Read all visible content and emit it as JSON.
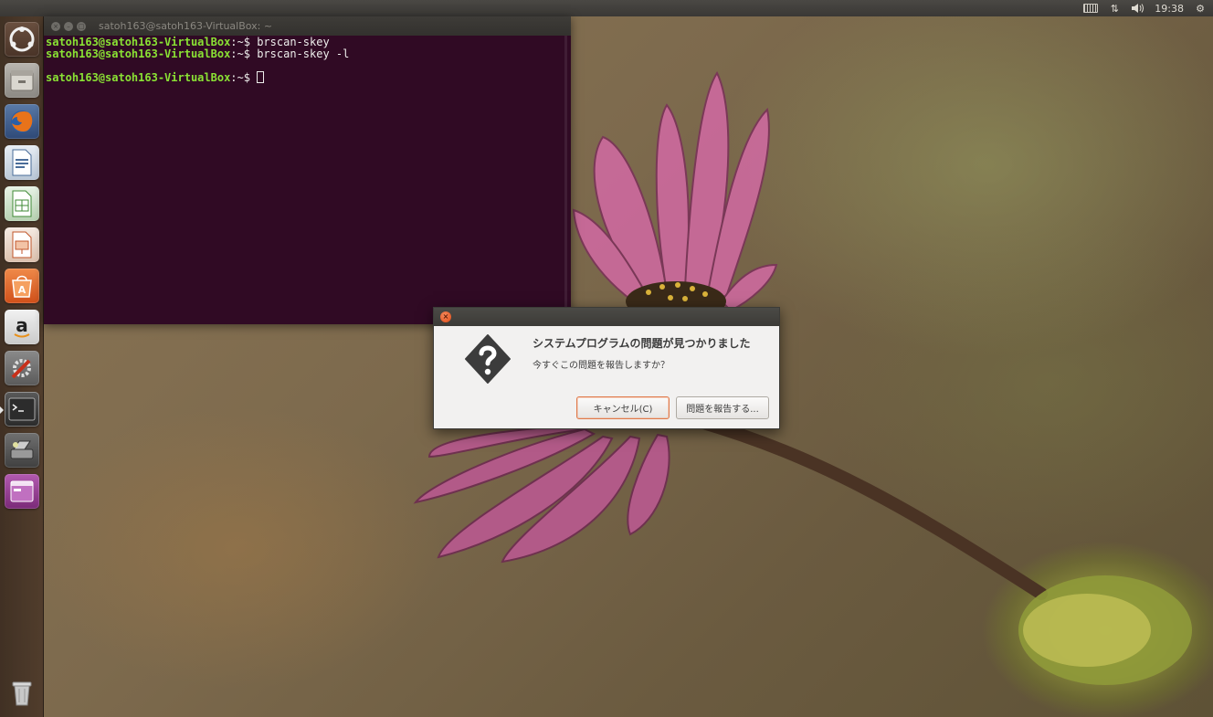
{
  "top_panel": {
    "clock": "19:38",
    "indicators": [
      "keyboard-icon",
      "network-icon",
      "volume-icon",
      "power-gear-icon"
    ]
  },
  "launcher": {
    "items": [
      "ubuntu-dash-icon",
      "files-icon",
      "firefox-icon",
      "libreoffice-writer-icon",
      "libreoffice-calc-icon",
      "libreoffice-impress-icon",
      "software-center-icon",
      "amazon-icon",
      "system-settings-icon",
      "terminal-icon",
      "scanner-icon",
      "window-app-icon",
      "trash-icon"
    ]
  },
  "terminal": {
    "title": "satoh163@satoh163-VirtualBox: ~",
    "lines": [
      {
        "prompt": "satoh163@satoh163-VirtualBox",
        "path": ":~$ ",
        "command": "brscan-skey"
      },
      {
        "prompt": "satoh163@satoh163-VirtualBox",
        "path": ":~$ ",
        "command": "brscan-skey -l"
      },
      {
        "prompt": "",
        "path": "",
        "command": ""
      },
      {
        "prompt": "satoh163@satoh163-VirtualBox",
        "path": ":~$ ",
        "command": ""
      }
    ]
  },
  "dialog": {
    "heading": "システムプログラムの問題が見つかりました",
    "message": "今すぐこの問題を報告しますか？",
    "cancel_label": "キャンセル(C)",
    "report_label": "問題を報告する..."
  },
  "colors": {
    "terminal_bg": "#300a24",
    "prompt": "#8ae234",
    "accent": "#df4a16"
  }
}
